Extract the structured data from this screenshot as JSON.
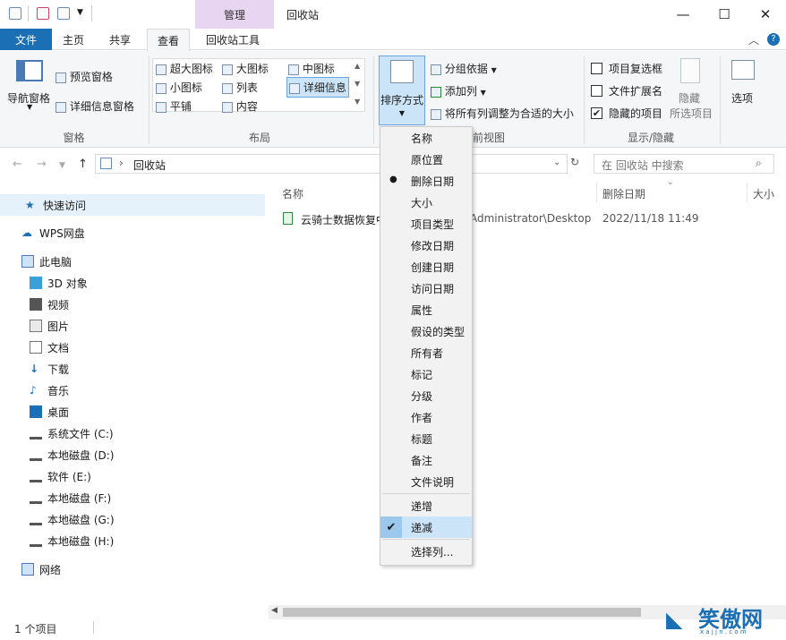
{
  "window": {
    "context_tab": "管理",
    "title": "回收站",
    "min": "—",
    "max": "☐",
    "close": "✕"
  },
  "tabs": {
    "file": "文件",
    "home": "主页",
    "share": "共享",
    "view": "查看",
    "recycle_tools": "回收站工具"
  },
  "ribbon": {
    "pane": {
      "nav": "导航窗格",
      "preview": "预览窗格",
      "details": "详细信息窗格",
      "group": "窗格"
    },
    "layout": {
      "xl": "超大图标",
      "large": "大图标",
      "medium": "中图标",
      "small": "小图标",
      "list": "列表",
      "details": "详细信息",
      "tiles": "平铺",
      "content": "内容",
      "group": "布局"
    },
    "view": {
      "sort": "排序方式",
      "groupby": "分组依据",
      "addcol": "添加列",
      "fitcols": "将所有列调整为合适的大小",
      "group_suffix": "前视图"
    },
    "showhide": {
      "item_cb": "项目复选框",
      "ext": "文件扩展名",
      "hidden": "隐藏的项目",
      "hide": "隐藏",
      "hide_sel": "所选项目",
      "group": "显示/隐藏"
    },
    "options": "选项"
  },
  "address": {
    "path": "回收站",
    "search_placeholder": "在 回收站 中搜索"
  },
  "nav": {
    "quick": "快速访问",
    "wps": "WPS网盘",
    "pc": "此电脑",
    "obj3d": "3D 对象",
    "video": "视频",
    "pics": "图片",
    "docs": "文档",
    "dl": "下载",
    "music": "音乐",
    "desktop": "桌面",
    "c": "系统文件 (C:)",
    "d": "本地磁盘 (D:)",
    "e": "软件 (E:)",
    "f": "本地磁盘 (F:)",
    "g": "本地磁盘 (G:)",
    "h": "本地磁盘 (H:)",
    "net": "网络"
  },
  "columns": {
    "name": "名称",
    "deleted": "删除日期",
    "size": "大小"
  },
  "file": {
    "name": "云骑士数据恢复中",
    "location": "Administrator\\Desktop",
    "date": "2022/11/18 11:49"
  },
  "menu": {
    "items": [
      "名称",
      "原位置",
      "删除日期",
      "大小",
      "项目类型",
      "修改日期",
      "创建日期",
      "访问日期",
      "属性",
      "假设的类型",
      "所有者",
      "标记",
      "分级",
      "作者",
      "标题",
      "备注",
      "文件说明"
    ],
    "asc": "递增",
    "desc": "递减",
    "choose": "选择列..."
  },
  "status": {
    "count": "1 个项目"
  },
  "watermark": {
    "text": "笑傲网",
    "url": "x a j j n . c o m"
  }
}
